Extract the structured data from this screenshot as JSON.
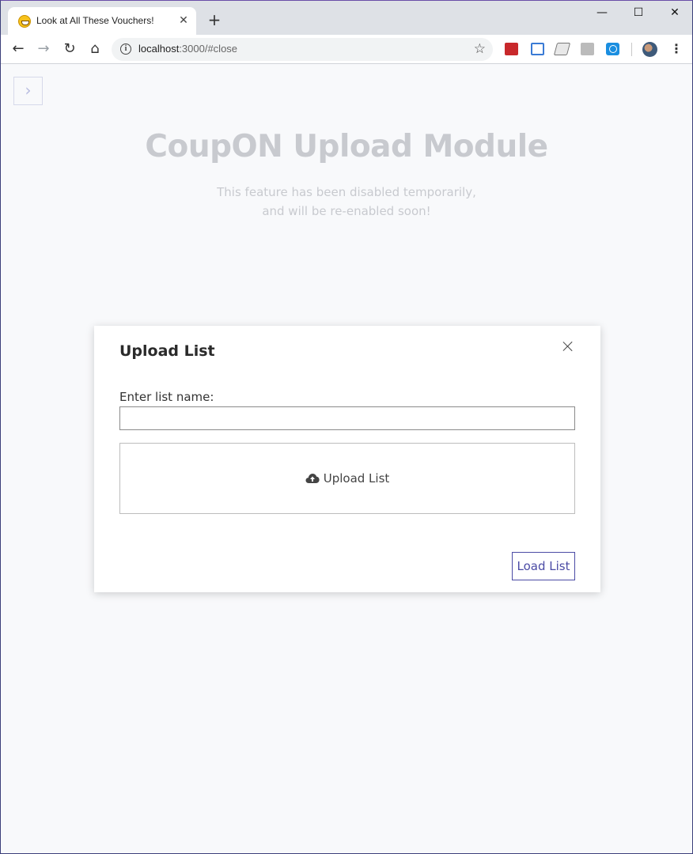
{
  "browser": {
    "tab_title": "Look at All These Vouchers!",
    "tab_close": "✕",
    "new_tab": "+",
    "window_controls": {
      "minimize": "—",
      "maximize": "☐",
      "close": "✕"
    },
    "nav": {
      "back": "←",
      "forward": "→",
      "reload": "↻",
      "home": "⌂"
    },
    "url_host": "localhost",
    "url_rest": ":3000/#close",
    "bookmark_star": "☆",
    "menu": "⋮",
    "extensions": [
      "ext-red-icon",
      "ext-blue-bracket-icon",
      "ext-ticket-icon",
      "ext-grey-icon",
      "ext-blue-clock-icon"
    ]
  },
  "page": {
    "sidebar_toggle": "›",
    "title": "CoupON Upload Module",
    "subtitle": "This feature has been disabled temporarily, and will be re-enabled soon!"
  },
  "modal": {
    "title": "Upload List",
    "name_label": "Enter list name:",
    "name_value": "",
    "upload_label": "Upload List",
    "load_button": "Load List",
    "accent_color": "#4b4ba5"
  }
}
